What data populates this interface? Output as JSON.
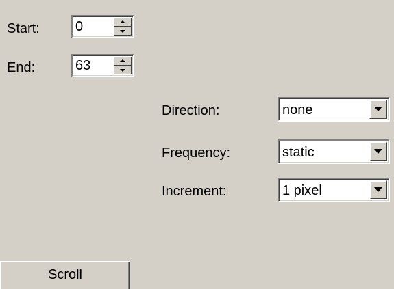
{
  "range": {
    "start_label": "Start:",
    "start_value": "0",
    "end_label": "End:",
    "end_value": "63"
  },
  "options": {
    "direction_label": "Direction:",
    "direction_value": "none",
    "frequency_label": "Frequency:",
    "frequency_value": "static",
    "increment_label": "Increment:",
    "increment_value": "1 pixel"
  },
  "actions": {
    "scroll_label": "Scroll"
  },
  "icons": {
    "spin_up": "spin-up-arrow",
    "spin_down": "spin-down-arrow",
    "dropdown": "chevron-down"
  },
  "colors": {
    "panel_background": "#d4d0c8",
    "field_background": "#ffffff"
  }
}
